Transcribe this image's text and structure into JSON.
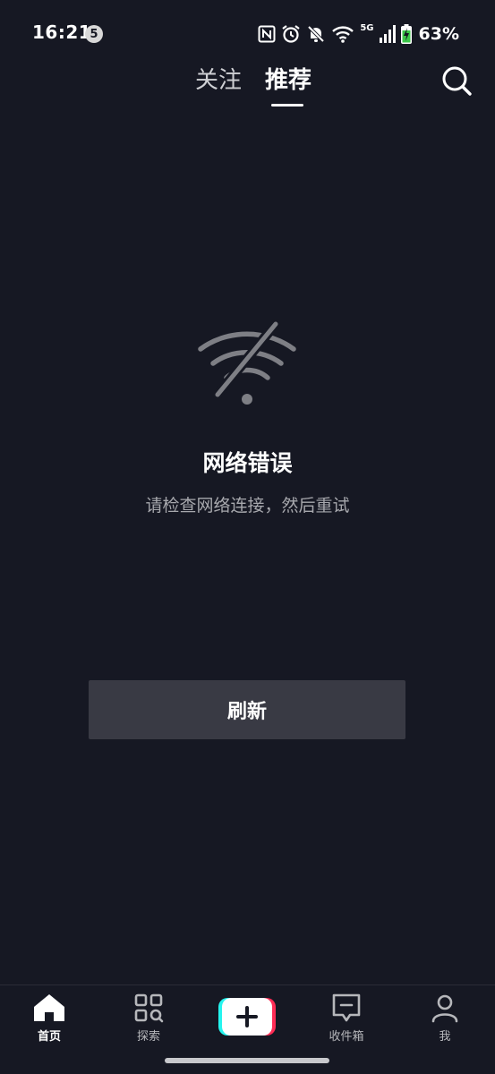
{
  "status_bar": {
    "time": "16:21",
    "notification_count": "5",
    "network_type": "5G",
    "battery": "63%"
  },
  "top_nav": {
    "tabs": [
      {
        "label": "关注",
        "active": false
      },
      {
        "label": "推荐",
        "active": true
      }
    ],
    "search_icon": "search-icon"
  },
  "error": {
    "icon": "wifi-off-icon",
    "title": "网络错误",
    "subtitle": "请检查网络连接，然后重试"
  },
  "refresh_button": {
    "label": "刷新"
  },
  "bottom_nav": {
    "items": [
      {
        "label": "首页",
        "icon": "home-icon",
        "active": true
      },
      {
        "label": "探索",
        "icon": "explore-icon",
        "active": false
      },
      {
        "label": "",
        "icon": "create-plus-icon",
        "active": false
      },
      {
        "label": "收件箱",
        "icon": "inbox-icon",
        "active": false
      },
      {
        "label": "我",
        "icon": "profile-icon",
        "active": false
      }
    ]
  },
  "colors": {
    "background": "#161823",
    "button": "#393a44",
    "accent_cyan": "#25f4ee",
    "accent_red": "#fe2c55",
    "battery_green": "#3cc84a"
  }
}
